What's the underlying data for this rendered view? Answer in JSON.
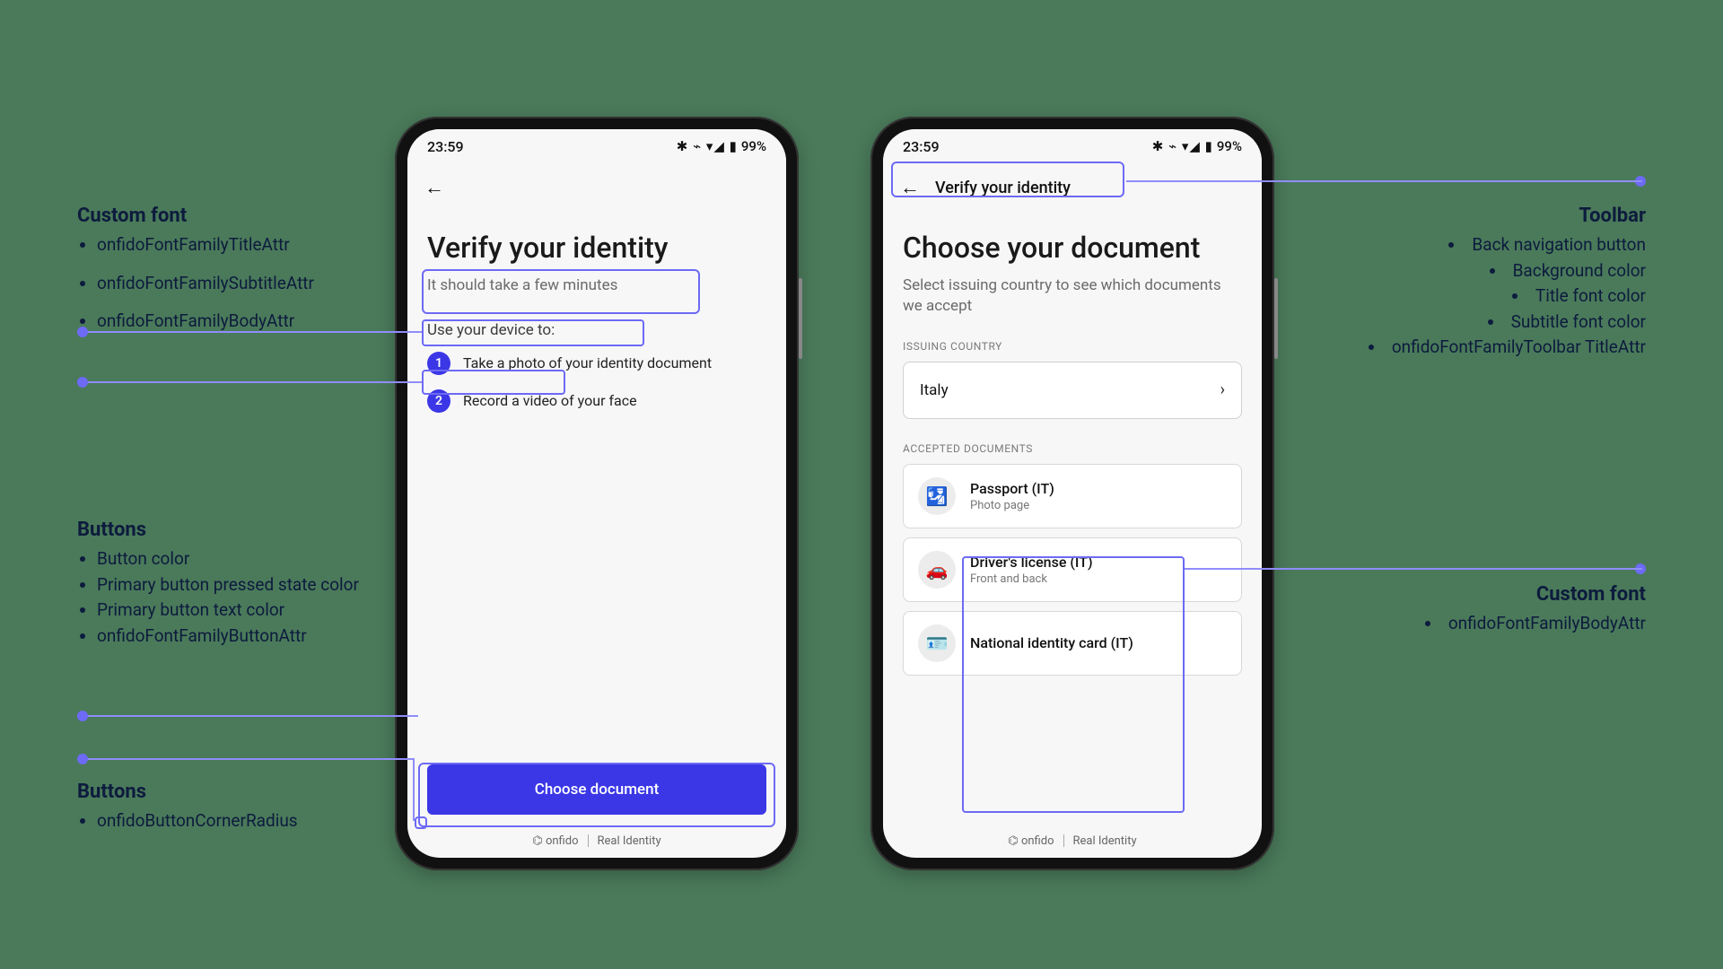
{
  "status": {
    "time": "23:59",
    "battery": "99%"
  },
  "screen_a": {
    "title": "Verify your identity",
    "subtitle": "It should take a few minutes",
    "section_label": "Use your device to:",
    "steps": [
      {
        "num": "1",
        "text": "Take a photo of your identity document"
      },
      {
        "num": "2",
        "text": "Record a video of your face"
      }
    ],
    "primary_button": "Choose document"
  },
  "screen_b": {
    "toolbar_title": "Verify your identity",
    "title": "Choose your document",
    "subtitle": "Select issuing country to see which documents we accept",
    "issuing_label": "ISSUING COUNTRY",
    "country": "Italy",
    "accepted_label": "ACCEPTED DOCUMENTS",
    "docs": [
      {
        "title": "Passport (IT)",
        "sub": "Photo page"
      },
      {
        "title": "Driver's license (IT)",
        "sub": "Front and back"
      },
      {
        "title": "National identity card (IT)",
        "sub": ""
      }
    ]
  },
  "footer": {
    "brand": "onfido",
    "tag": "Real Identity"
  },
  "annotations": {
    "custom_font": {
      "heading": "Custom font",
      "items": [
        "onfidoFontFamilyTitleAttr",
        "onfidoFontFamilySubtitleAttr",
        "onfidoFontFamilyBodyAttr"
      ]
    },
    "buttons_a": {
      "heading": "Buttons",
      "items": [
        "Button color",
        "Primary button pressed state color",
        "Primary button text color",
        "onfidoFontFamilyButtonAttr"
      ]
    },
    "buttons_b": {
      "heading": "Buttons",
      "items": [
        "onfidoButtonCornerRadius"
      ]
    },
    "toolbar": {
      "heading": "Toolbar",
      "items": [
        "Back navigation button",
        "Background color",
        "Title font color",
        "Subtitle font color",
        "onfidoFontFamilyToolbar TitleAttr"
      ]
    },
    "custom_font_body": {
      "heading": "Custom font",
      "items": [
        "onfidoFontFamilyBodyAttr"
      ]
    }
  }
}
